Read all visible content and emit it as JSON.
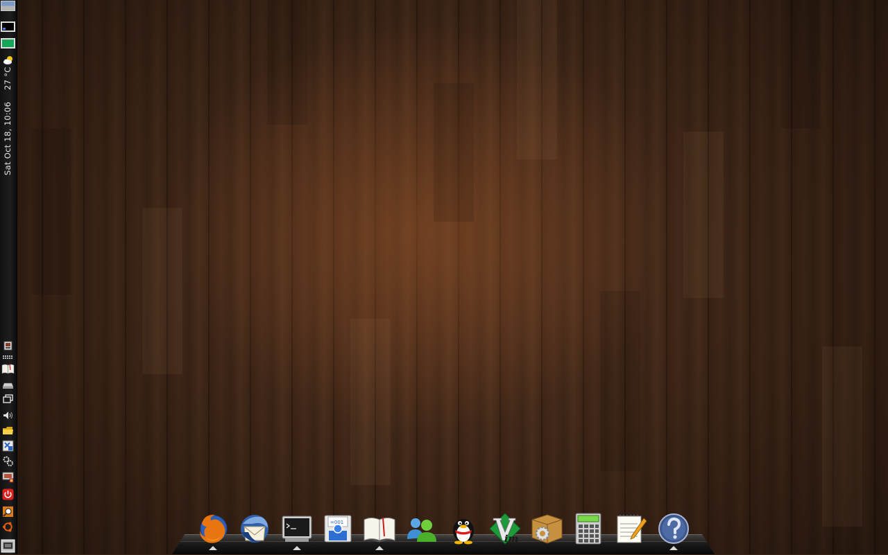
{
  "desktop": {
    "wallpaper": "wood-planks",
    "accent_color": "#4e301d"
  },
  "left_panel": {
    "workspaces": [
      "workspace-1",
      "workspace-2",
      "workspace-3"
    ],
    "weather": {
      "icon": "partly-cloudy-icon",
      "temperature": "27 °C"
    },
    "clock": "Sat Oct 18, 10:06",
    "tray_icons": [
      "window-list-icon",
      "grip-dots-icon",
      "stardict-icon",
      "drive-icon",
      "windows-icon",
      "volume-icon",
      "folder-icon",
      "network-icon",
      "preferences-icon",
      "display-settings-icon",
      "power-icon",
      "search-icon",
      "ubuntu-icon",
      "show-desktop-icon"
    ]
  },
  "dock": {
    "items": [
      {
        "name": "Firefox",
        "icon": "firefox-icon",
        "running": true
      },
      {
        "name": "Thunderbird",
        "icon": "thunderbird-icon",
        "running": false
      },
      {
        "name": "Terminal",
        "icon": "terminal-icon",
        "running": true
      },
      {
        "name": "Backup",
        "icon": "backup-floppy-icon",
        "running": false
      },
      {
        "name": "Dictionary",
        "icon": "dictionary-book-icon",
        "running": true
      },
      {
        "name": "Messenger",
        "icon": "messenger-people-icon",
        "running": false
      },
      {
        "name": "QQ",
        "icon": "qq-penguin-icon",
        "running": false
      },
      {
        "name": "Vim",
        "icon": "vim-icon",
        "running": false
      },
      {
        "name": "Package Manager",
        "icon": "package-gear-icon",
        "running": false
      },
      {
        "name": "Calculator",
        "icon": "calculator-icon",
        "running": false
      },
      {
        "name": "Text Editor",
        "icon": "notepad-pencil-icon",
        "running": false
      },
      {
        "name": "Help",
        "icon": "help-icon",
        "running": true
      }
    ]
  }
}
